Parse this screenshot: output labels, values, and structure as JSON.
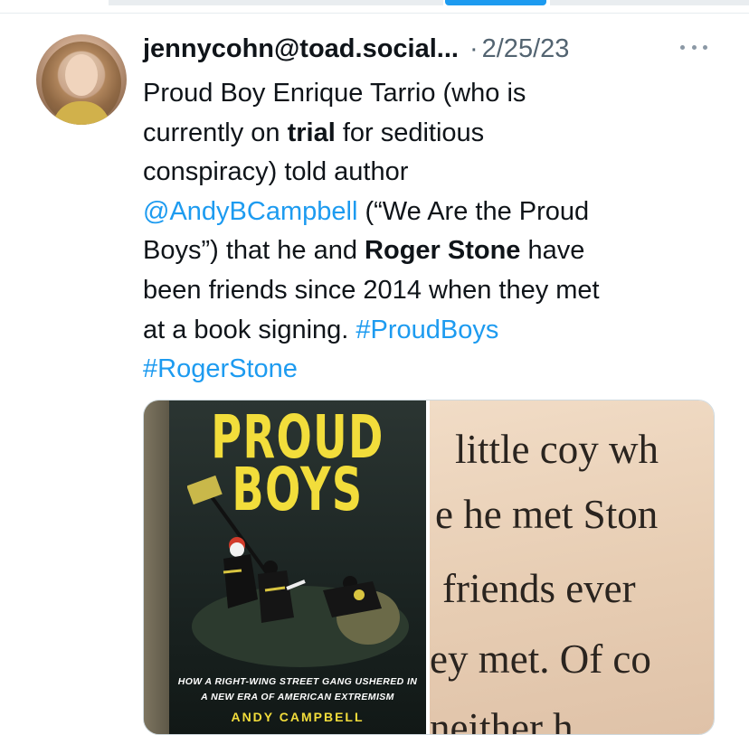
{
  "tweet": {
    "handle": "jennycohn@toad.social...",
    "separator": "·",
    "date": "2/25/23",
    "text_lines": [
      [
        "Proud Boy Enrique Tarrio (who is"
      ],
      [
        "currently on ",
        "trial",
        " for seditious"
      ],
      [
        "conspiracy) told author"
      ],
      [
        "@AndyBCampbell",
        " (“We Are the Proud"
      ],
      [
        "Boys”) that he and ",
        "Roger Stone",
        " have"
      ],
      [
        "been friends since 2014 when they met"
      ],
      [
        "at a book signing. ",
        "#ProudBoys"
      ],
      [
        "#RogerStone"
      ]
    ]
  },
  "media": {
    "book_cover": {
      "title_line1": "PROUD",
      "title_line2": "BOYS",
      "subtitle_line1": "HOW A RIGHT-WING STREET GANG USHERED IN",
      "subtitle_line2": "A NEW ERA OF AMERICAN EXTREMISM",
      "author": "ANDY CAMPBELL"
    },
    "page_excerpt": {
      "lines": [
        "little coy wh",
        "e he met Ston",
        "friends ever",
        "ey met. Of co",
        "neither h"
      ]
    }
  },
  "colors": {
    "link": "#1d9bf0",
    "text": "#0f1419",
    "muted": "#536471",
    "book_yellow": "#f2dd3b"
  },
  "icons": {
    "more": "more-horizontal-icon"
  }
}
